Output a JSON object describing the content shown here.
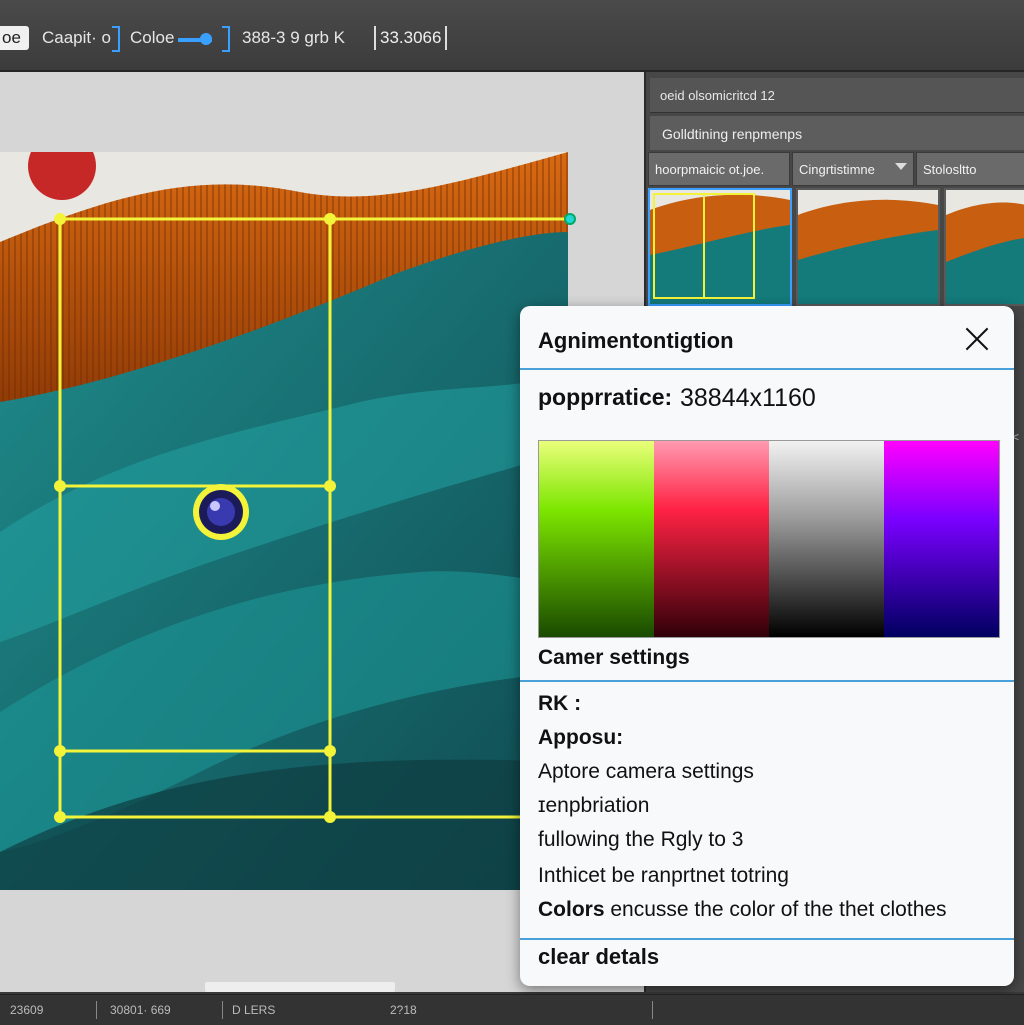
{
  "toolbar": {
    "mode": "oe",
    "capture": "Caapit· o",
    "color": "Coloe",
    "dims": "388-3  9 grb K",
    "value_field": "33.3066"
  },
  "right_panel": {
    "header": "oeid olsomicritcd 12",
    "section_title": "Golldtining renpmenps",
    "tabs": [
      "hoorpmaicic ot.joe.",
      "Cingrtistimne",
      "Stolosltto"
    ]
  },
  "dialog": {
    "title": "Agnimentontigtion",
    "resolution_label": "popprratice:",
    "resolution_value": "38844x1160",
    "swatch_colors": [
      "#7de600",
      "#ff2244",
      "#9a9a9a",
      "#7a00ff"
    ],
    "section_title": "Camer settings",
    "lines": [
      {
        "text": "RK :",
        "bold": true
      },
      {
        "text": "Apposu:",
        "bold": true
      },
      {
        "text": "Aptore camera settings",
        "bold": false
      },
      {
        "text": "ɪenpbriation",
        "bold": false
      },
      {
        "text": "fullowing the Rgly to 3",
        "bold": false
      },
      {
        "text": "Inthicet be ranprtnet totring",
        "bold": false
      }
    ],
    "colors_label": "Colors",
    "colors_text": " encusse the color of the thet clothes",
    "bottom": "clear detals"
  },
  "statusbar": {
    "left": "23609",
    "mid": "30801· 669",
    "mode": "D LERS",
    "right": "2?18"
  },
  "colors": {
    "guide": "#f3f33a",
    "accent": "#3aa0ff",
    "rule": "#4aa0d8"
  }
}
